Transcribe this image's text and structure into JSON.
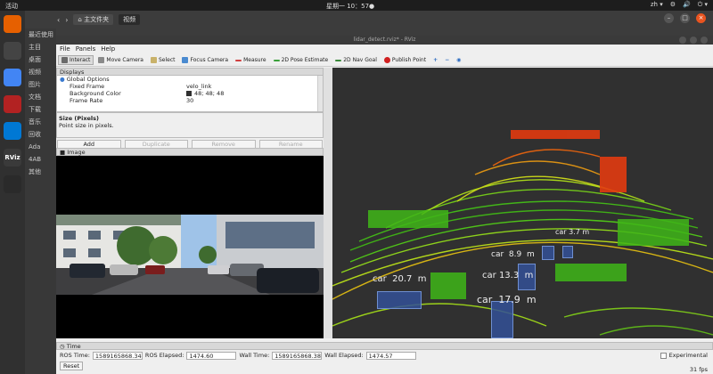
{
  "topbar": {
    "activities": "活动",
    "clock": "星期一 10：57●",
    "tray": [
      "zh ▾",
      "⚙",
      "🔊",
      "⏻ ▾"
    ]
  },
  "dock": [
    {
      "name": "firefox",
      "label": "",
      "color": "#e66000"
    },
    {
      "name": "settings",
      "label": "",
      "color": "#444444"
    },
    {
      "name": "chrome",
      "label": "",
      "color": "#4285f4"
    },
    {
      "name": "terminal",
      "label": "",
      "color": "#b22222"
    },
    {
      "name": "vscode",
      "label": "",
      "color": "#0078d4"
    },
    {
      "name": "rviz",
      "label": "RViz",
      "color": "#3a3a3a"
    },
    {
      "name": "video",
      "label": "",
      "color": "#2a2a2a"
    }
  ],
  "files": {
    "nav": [
      "‹",
      "›"
    ],
    "home": "⌂ 主文件夹",
    "current": "视频",
    "sidebar": [
      "最近使用",
      "主目",
      "桌面",
      "视频",
      "图片",
      "文档",
      "下载",
      "音乐",
      "回收",
      "Adа",
      "4AB",
      "其他"
    ]
  },
  "rviz": {
    "title": "lidar_detect.rviz* - RViz",
    "menu": [
      "File",
      "Panels",
      "Help"
    ],
    "tools": [
      {
        "label": "Interact",
        "icon": "cursor-icon",
        "color": "#6a6a6a",
        "active": true
      },
      {
        "label": "Move Camera",
        "icon": "move-camera-icon",
        "color": "#8a8a8a"
      },
      {
        "label": "Select",
        "icon": "select-icon",
        "color": "#c9b26a"
      },
      {
        "label": "Focus Camera",
        "icon": "focus-camera-icon",
        "color": "#4a8ad0"
      },
      {
        "label": "Measure",
        "icon": "measure-icon",
        "color": "#d04040"
      },
      {
        "label": "2D Pose Estimate",
        "icon": "pose-estimate-icon",
        "color": "#3aa03a"
      },
      {
        "label": "2D Nav Goal",
        "icon": "nav-goal-icon",
        "color": "#3a8a3a"
      },
      {
        "label": "Publish Point",
        "icon": "publish-point-icon",
        "color": "#d02020"
      }
    ],
    "displays": {
      "header": "Displays",
      "rows": [
        {
          "name": "Global Options",
          "value": ""
        },
        {
          "name": "Fixed Frame",
          "value": "velo_link"
        },
        {
          "name": "Background Color",
          "value": "48; 48; 48"
        },
        {
          "name": "Frame Rate",
          "value": "30"
        }
      ],
      "desc_title": "Size (Pixels)",
      "desc_text": "Point size in pixels.",
      "buttons": [
        "Add",
        "Duplicate",
        "Remove",
        "Rename"
      ]
    },
    "image_panel": {
      "header": "Image"
    },
    "detections": [
      {
        "label": "car",
        "dist": "20.7",
        "unit": "m"
      },
      {
        "label": "car",
        "dist": "13.3",
        "unit": "m"
      },
      {
        "label": "car",
        "dist": "17.9",
        "unit": "m"
      },
      {
        "label": "car",
        "dist": "8.9",
        "unit": "m"
      },
      {
        "label": "car",
        "dist": "3.7",
        "unit": "m"
      }
    ],
    "time": {
      "header": "Time",
      "ros_time_label": "ROS Time:",
      "ros_time": "1589165868.34",
      "ros_elapsed_label": "ROS Elapsed:",
      "ros_elapsed": "1474.60",
      "wall_time_label": "Wall Time:",
      "wall_time": "1589165868.38",
      "wall_elapsed_label": "Wall Elapsed:",
      "wall_elapsed": "1474.57",
      "experimental": "Experimental",
      "reset": "Reset",
      "fps": "31 fps"
    }
  }
}
